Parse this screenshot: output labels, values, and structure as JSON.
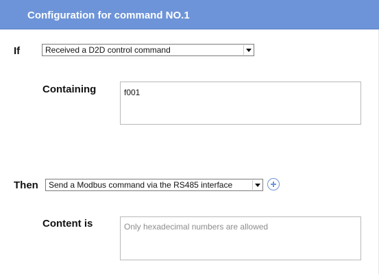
{
  "header": {
    "title": "Configuration for command NO.1"
  },
  "condition": {
    "keyword": "If",
    "trigger_value": "Received a D2D control command",
    "containing_label": "Containing",
    "containing_value": "f001"
  },
  "action": {
    "keyword": "Then",
    "action_value": "Send a Modbus command via the RS485 interface",
    "content_label": "Content is",
    "content_value": "",
    "content_placeholder": "Only hexadecimal numbers are allowed",
    "add_icon": "plus-circle-icon"
  },
  "colors": {
    "header_bg": "#6d94d8",
    "accent": "#6d94d8"
  }
}
